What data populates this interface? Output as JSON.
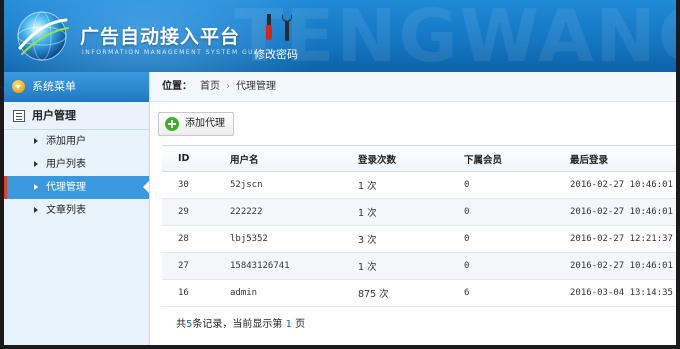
{
  "header": {
    "title": "广告自动接入平台",
    "subtitle": "INFORMATION MANAGEMENT SYSTEM GUI",
    "change_password": "修改密码",
    "watermark": "TENGWANGLUO"
  },
  "sidebar": {
    "menu_title": "系统菜单",
    "group_title": "用户管理",
    "items": [
      {
        "label": "添加用户"
      },
      {
        "label": "用户列表"
      },
      {
        "label": "代理管理"
      },
      {
        "label": "文章列表"
      }
    ]
  },
  "breadcrumb": {
    "prefix": "位置：",
    "home": "首页",
    "current": "代理管理"
  },
  "toolbar": {
    "add_agent_label": "添加代理"
  },
  "table": {
    "headers": [
      "ID",
      "用户名",
      "登录次数",
      "下属会员",
      "最后登录"
    ],
    "rows": [
      {
        "id": "30",
        "username": "52jscn",
        "logins": "1 次",
        "members": "0",
        "last_login": "2016-02-27 10:46:01"
      },
      {
        "id": "29",
        "username": "222222",
        "logins": "1 次",
        "members": "0",
        "last_login": "2016-02-27 10:46:01"
      },
      {
        "id": "28",
        "username": "lbj5352",
        "logins": "3 次",
        "members": "0",
        "last_login": "2016-02-27 12:21:37"
      },
      {
        "id": "27",
        "username": "15843126741",
        "logins": "1 次",
        "members": "0",
        "last_login": "2016-02-27 10:46:01"
      },
      {
        "id": "16",
        "username": "admin",
        "logins": "875 次",
        "members": "6",
        "last_login": "2016-03-04 13:14:35"
      }
    ]
  },
  "pagination": {
    "text_a": "共",
    "total": "5",
    "text_b": "条记录，当前显示第",
    "page": "1",
    "text_c": "页"
  },
  "colors": {
    "header_blue": "#1577c3",
    "active_item": "#3a98de",
    "active_marker": "#e53b2b",
    "add_icon": "#3fae29"
  }
}
